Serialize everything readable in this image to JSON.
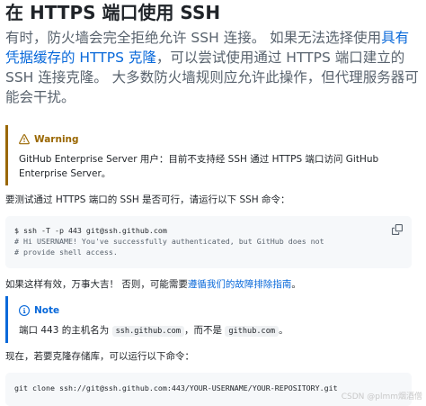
{
  "heading": "在 HTTPS 端口使用 SSH",
  "lead": {
    "text_before": "有时，防火墙会完全拒绝允许 SSH 连接。 如果无法选择使用",
    "link_text": "具有凭据缓存的 HTTPS 克隆",
    "text_after": "，可以尝试使用通过 HTTPS 端口建立的 SSH 连接克隆。 大多数防火墙规则应允许此操作，但代理服务器可能会干扰。"
  },
  "warning": {
    "title": "Warning",
    "body": "GitHub Enterprise Server 用户：目前不支持经 SSH 通过 HTTPS 端口访问 GitHub Enterprise Server。"
  },
  "test_intro": "要测试通过 HTTPS 端口的 SSH 是否可行，请运行以下 SSH 命令：",
  "code1": {
    "command": "$ ssh -T -p 443 git@ssh.github.com",
    "comment1": "# Hi USERNAME! You've successfully authenticated, but GitHub does not",
    "comment2": "# provide shell access."
  },
  "if_works": {
    "text_before": "如果这样有效，万事大吉！ 否则，可能需要",
    "link_text": "遵循我们的故障排除指南",
    "text_after": "。"
  },
  "note": {
    "title": "Note",
    "body_before": "端口 443 的主机名为 ",
    "code_a": "ssh.github.com",
    "body_middle": "，而不是 ",
    "code_b": "github.com",
    "body_after": "。"
  },
  "clone_intro": "现在，若要克隆存储库，可以运行以下命令：",
  "code2": {
    "command": "git clone ssh://git@ssh.github.com:443/YOUR-USERNAME/YOUR-REPOSITORY.git"
  },
  "watermark": "CSDN @plmm烟酒僧",
  "colors": {
    "link": "#0969da",
    "warning": "#9a6700",
    "note": "#0969da",
    "code_bg": "#f6f8fa"
  },
  "icons": {
    "warning": "alert-triangle-icon",
    "note": "info-circle-icon",
    "copy": "copy-icon"
  }
}
